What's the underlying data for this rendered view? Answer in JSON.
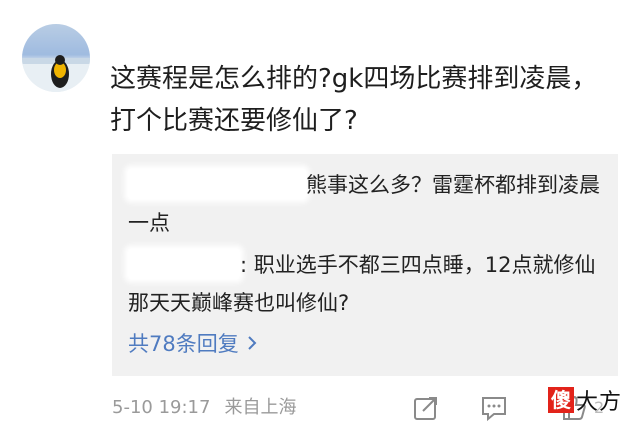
{
  "comment": {
    "text": "这赛程是怎么排的?gk四场比赛排到凌晨，打个比赛还要修仙了?",
    "timestamp": "5-10 19:17",
    "source": "来自上海"
  },
  "replies": [
    {
      "text": "熊事这么多？雷霆杯都排到凌晨一点"
    },
    {
      "text": ": 职业选手不都三四点睡，12点就修仙那天天巅峰赛也叫修仙?"
    }
  ],
  "more_replies_label": "共78条回复",
  "action_count": "2",
  "watermark": {
    "box_char": "傻",
    "rest": "大方"
  },
  "icons": [
    "avatar",
    "chevron-right-icon",
    "share-icon",
    "comment-icon",
    "like-icon"
  ],
  "colors": {
    "link": "#4f7bc0",
    "reply_bg": "#f1f1f1",
    "meta": "#9a9a9a"
  }
}
